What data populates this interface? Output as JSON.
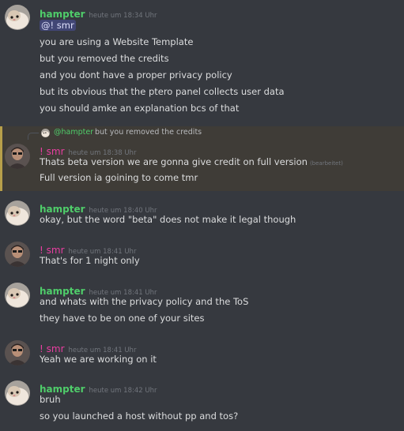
{
  "messages": [
    {
      "username": "hampter",
      "timestamp": "heute um 18:34 Uhr",
      "mention": "@! smr",
      "lines": [
        "you are using a Website Template",
        "but you removed the credits",
        "and you dont have a proper privacy policy",
        "but its obvious that the ptero panel collects user data",
        "you should amke an explanation bcs of that"
      ]
    },
    {
      "reply_mention": "@hampter",
      "reply_text": "but you removed the credits",
      "username": "! smr",
      "timestamp": "heute um 18:38 Uhr",
      "lines": [
        "Thats beta version we are gonna give credit on full version",
        "Full version ia goining to come tmr"
      ],
      "edited_label": "(bearbeitet)"
    },
    {
      "username": "hampter",
      "timestamp": "heute um 18:40 Uhr",
      "lines": [
        "okay, but the word \"beta\" does not make it legal though"
      ]
    },
    {
      "username": "! smr",
      "timestamp": "heute um 18:41 Uhr",
      "lines": [
        "That's for 1 night only"
      ]
    },
    {
      "username": "hampter",
      "timestamp": "heute um 18:41 Uhr",
      "lines": [
        "and whats with the privacy policy and the ToS",
        "they have to be on one of your sites"
      ]
    },
    {
      "username": "! smr",
      "timestamp": "heute um 18:41 Uhr",
      "lines": [
        "Yeah we are working on it"
      ]
    },
    {
      "username": "hampter",
      "timestamp": "heute um 18:42 Uhr",
      "lines": [
        "bruh",
        "so you launched a host without pp and tos?"
      ]
    }
  ],
  "colors": {
    "background": "#36393f",
    "hampter_name": "#4fcd6a",
    "smr_name": "#e93ea1",
    "message_text": "#dcddde",
    "timestamp": "#72767d",
    "mention_bg": "#414675",
    "highlight_border": "#b79f4a"
  },
  "icons": {
    "hampter_avatar": "hamster-avatar-icon",
    "smr_avatar": "person-avatar-icon",
    "reply": "reply-curve-icon"
  }
}
